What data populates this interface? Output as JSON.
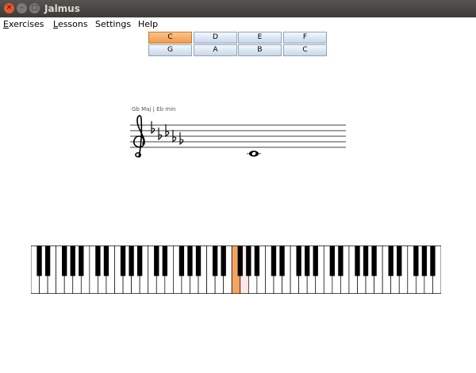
{
  "window": {
    "title": "Jalmus",
    "close_glyph": "✕",
    "minimize_glyph": "–",
    "maximize_glyph": "□"
  },
  "menu": [
    {
      "mnemonic": "E",
      "rest": "xercises"
    },
    {
      "mnemonic": "L",
      "rest": "essons"
    },
    {
      "mnemonic": "",
      "rest": "Settings"
    },
    {
      "mnemonic": "",
      "rest": "Help"
    }
  ],
  "answers": {
    "row1": [
      "C",
      "D",
      "E",
      "F"
    ],
    "row2": [
      "G",
      "A",
      "B",
      "C"
    ],
    "selected": "row1-0",
    "highlight_color": "#f4a460"
  },
  "staff": {
    "key_label": "Gb Maj | Eb min",
    "clef": "treble-clef-icon",
    "key_signature": [
      "Bb",
      "Eb",
      "Ab",
      "Db",
      "Gb"
    ],
    "note": {
      "pitch": "C4",
      "duration": "whole"
    }
  },
  "piano": {
    "white_key_count": 49,
    "pressed_key": "C4",
    "pressed_color": "#f4a460",
    "hint_key_color": "#fde8e8"
  }
}
